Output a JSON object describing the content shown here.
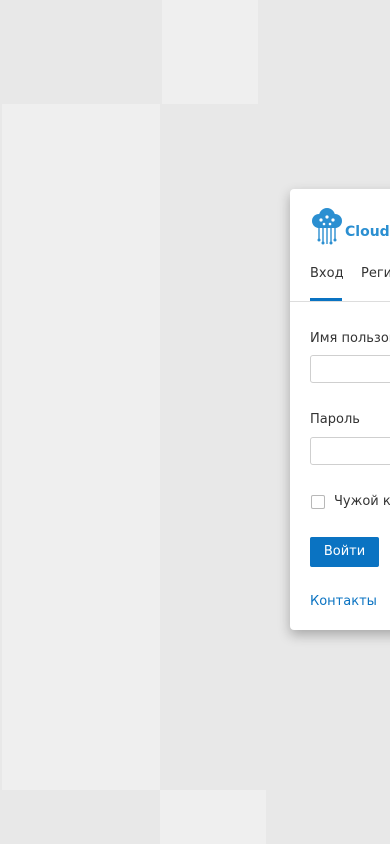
{
  "brand": {
    "name": "CloudPa",
    "logo_icon": "tree-cloud-icon",
    "accent_color": "#2b8fd1"
  },
  "tabs": [
    {
      "label": "Вход",
      "active": true
    },
    {
      "label": "Реги",
      "active": false
    }
  ],
  "form": {
    "username_label": "Имя пользов",
    "username_value": "",
    "password_label": "Пароль",
    "password_value": "",
    "remember_label": "Чужой ко",
    "remember_checked": false,
    "submit_label": "Войти"
  },
  "footer": {
    "contacts_label": "Контакты"
  },
  "colors": {
    "primary": "#0a73c2",
    "background": "#e8e8e8"
  }
}
